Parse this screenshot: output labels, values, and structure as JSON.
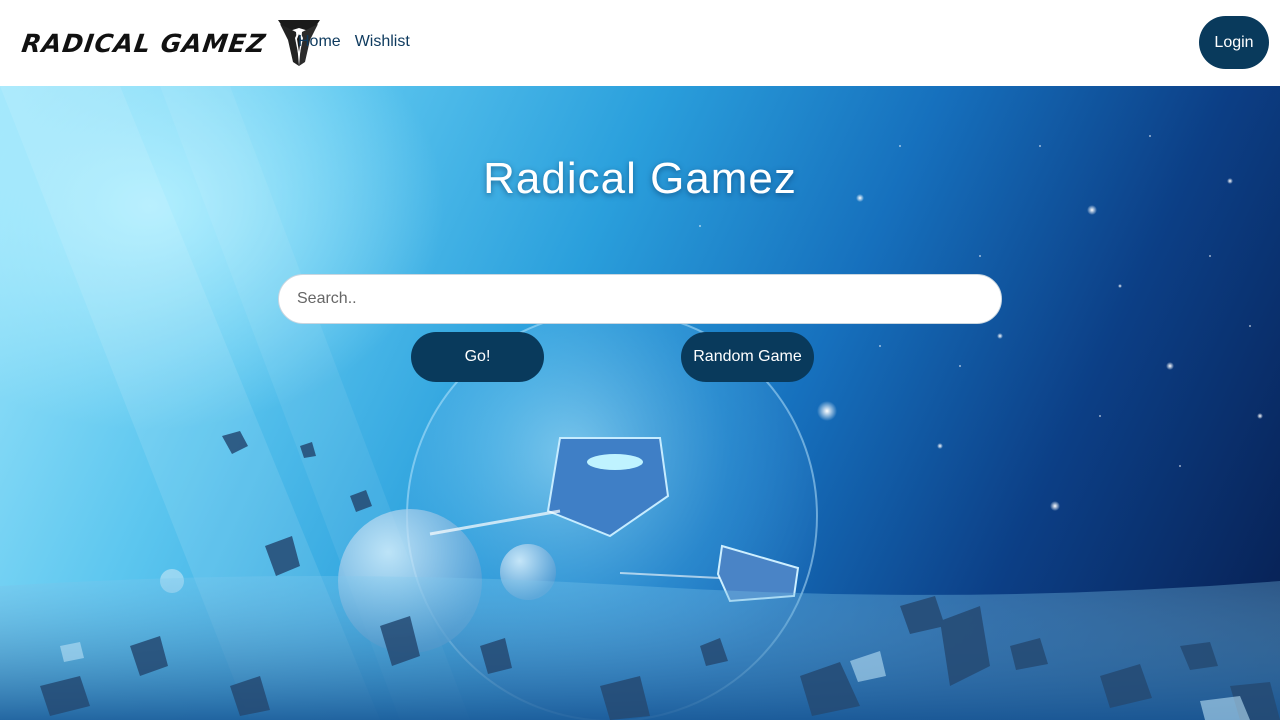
{
  "navbar": {
    "brand_name": "RADICAL GAMEZ",
    "brand_logo_icon": "radical-gamez-logo",
    "links": [
      {
        "label": "Home"
      },
      {
        "label": "Wishlist"
      }
    ],
    "login_label": "Login"
  },
  "hero": {
    "title": "Radical Gamez",
    "search": {
      "placeholder": "Search..",
      "value": ""
    },
    "go_label": "Go!",
    "random_label": "Random Game",
    "background": "space-asteroid-scene"
  },
  "colors": {
    "button_bg": "#093a5c",
    "link_color": "#0e3a5e",
    "navbar_bg": "#ffffff"
  }
}
